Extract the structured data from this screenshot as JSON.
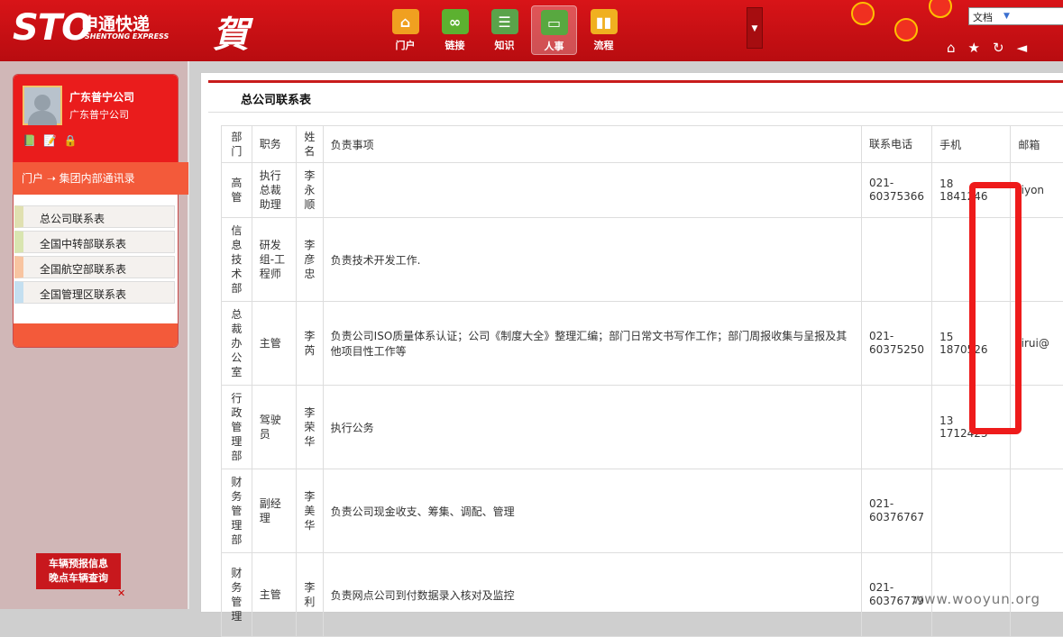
{
  "header": {
    "logo_main": "STO",
    "logo_cn": "申通快递",
    "logo_en": "SHENTONG EXPRESS",
    "greeting": "賀",
    "nav": [
      {
        "label": "门户",
        "icon": "home-icon",
        "color": "#f0a020"
      },
      {
        "label": "链接",
        "icon": "link-icon",
        "color": "#5cb130"
      },
      {
        "label": "知识",
        "icon": "book-icon",
        "color": "#5aa34a"
      },
      {
        "label": "人事",
        "icon": "card-icon",
        "color": "#58a840"
      },
      {
        "label": "流程",
        "icon": "chart-icon",
        "color": "#f0b020"
      }
    ],
    "search_select": "文档"
  },
  "sidebar": {
    "user_name": "广东普宁公司",
    "user_org": "广东普宁公司",
    "breadcrumb": "门户 ➝ 集团内部通讯录",
    "menu": [
      {
        "label": "总公司联系表",
        "color": "#e0e0b0"
      },
      {
        "label": "全国中转部联系表",
        "color": "#d9e5b0"
      },
      {
        "label": "全国航空部联系表",
        "color": "#f8c4a0"
      },
      {
        "label": "全国管理区联系表",
        "color": "#c4dff0"
      }
    ],
    "notice_line1": "车辆预报信息",
    "notice_line2": "晚点车辆查询",
    "notice_close": "✕"
  },
  "main": {
    "title": "总公司联系表",
    "columns": [
      "部门",
      "职务",
      "姓名",
      "负责事项",
      "联系电话",
      "手机",
      "邮箱"
    ],
    "rows": [
      {
        "dept": "高管",
        "role": "执行总裁助理",
        "name": "李永顺",
        "duty": "",
        "phone": "021-60375366",
        "mobile": "18 1841246",
        "email": "liyon"
      },
      {
        "dept": "信息技术部",
        "role": "研发组-工程师",
        "name": "李彦忠",
        "duty": "负责技术开发工作.",
        "phone": "",
        "mobile": "",
        "email": ""
      },
      {
        "dept": "总裁办公室",
        "role": "主管",
        "name": "李芮",
        "duty": "负责公司ISO质量体系认证；公司《制度大全》整理汇编；部门日常文书写作工作；部门周报收集与呈报及其他项目性工作等",
        "phone": "021-60375250",
        "mobile": "15 1870526",
        "email": "lirui@"
      },
      {
        "dept": "行政管理部",
        "role": "驾驶员",
        "name": "李荣华",
        "duty": "执行公务",
        "phone": "",
        "mobile": "13 1712423",
        "email": ""
      },
      {
        "dept": "财务管理部",
        "role": "副经理",
        "name": "李美华",
        "duty": "负责公司现金收支、筹集、调配、管理",
        "phone": "021-60376767",
        "mobile": "",
        "email": ""
      },
      {
        "dept": "财务管理",
        "role": "主管",
        "name": "李利",
        "duty": "负责网点公司到付数据录入核对及监控",
        "phone": "021-60376779",
        "mobile": "",
        "email": ""
      }
    ]
  },
  "watermark": "www.wooyun.org"
}
